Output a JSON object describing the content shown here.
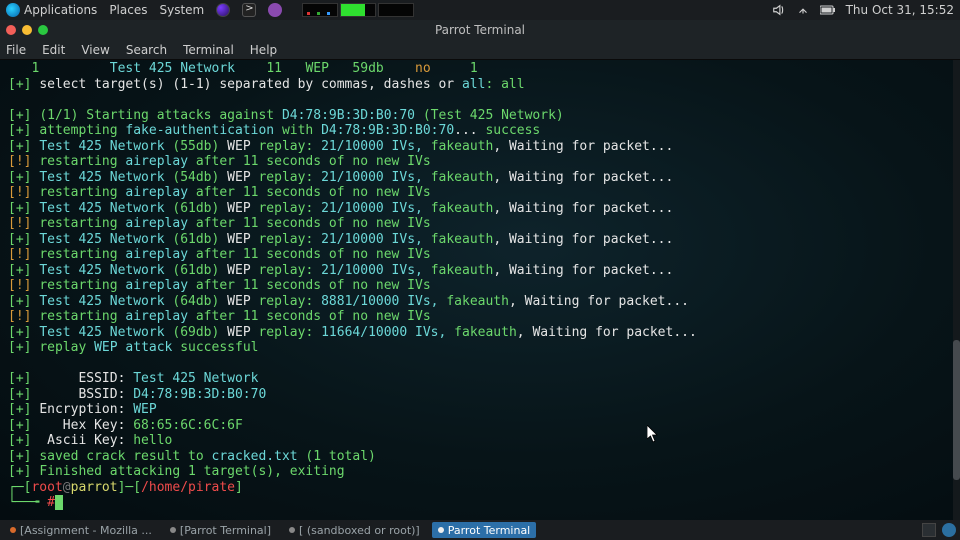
{
  "top_panel": {
    "app_menu": "Applications",
    "places": "Places",
    "system": "System",
    "clock": "Thu Oct 31, 15:52"
  },
  "window": {
    "title": "Parrot Terminal",
    "menu": {
      "file": "File",
      "edit": "Edit",
      "view": "View",
      "search": "Search",
      "terminal": "Terminal",
      "help": "Help"
    }
  },
  "term": {
    "scan_row": {
      "num": "1",
      "essid": "Test 425 Network",
      "ch": "11",
      "enc": "WEP",
      "pwr": "59db",
      "wps": "no",
      "cl": "1"
    },
    "select_prompt": "select target(s) (1-1) separated by commas, dashes or ",
    "select_all": "all",
    "select_answer": ": all",
    "start": "(1/1) Starting attacks against ",
    "bssid": "D4:78:9B:3D:B0:70",
    "start_tail": " (Test 425 Network)",
    "attempt": "attempting ",
    "fakeauth": "fake-authentication",
    "attempt2": " with ",
    "dots": "... ",
    "success": "success",
    "net_name": "Test 425 Network",
    "db55": "(55db)",
    "db54": "(54db)",
    "db61": "(61db)",
    "db64": "(64db)",
    "db69": "(69db)",
    "wep": " WEP",
    "replayw": " replay: ",
    "ivs21": "21/10000 IVs, ",
    "ivs8881": "8881/10000 IVs, ",
    "ivs11664": "11664/10000 IVs, ",
    "wait": ", Waiting for packet...",
    "fakeauth_s": "fakeauth",
    "restart1": "restarting ",
    "aireplay": "aireplay",
    "restart2": " after 11 seconds of no new IVs",
    "replay": "replay ",
    "wepattack": "WEP attack ",
    "successful": "successful",
    "essid_lbl": "     ESSID: ",
    "essid_val": "Test 425 Network",
    "bssid_lbl": "     BSSID: ",
    "enc_lbl": "Encryption: ",
    "enc_val": "WEP",
    "hex_lbl": "   Hex Key: ",
    "hex_val": "68:65:6C:6C:6F",
    "asc_lbl": " Ascii Key: ",
    "asc_val": "hello",
    "saved1": "saved crack result to ",
    "crackedfile": "cracked.txt",
    "saved2": " (1 total)",
    "finish": "Finished attacking 1 target(s), exiting",
    "p_root": "root",
    "p_at": "@",
    "p_host": "parrot",
    "p_sep1": "]",
    "p_dash": "─[",
    "p_path": "/home/pirate",
    "p_close": "]",
    "prompt2": "#"
  },
  "taskbar": {
    "t1": "[Assignment - Mozilla ...",
    "t2": "[Parrot Terminal]",
    "t3": "[ (sandboxed or root)]",
    "t4": "Parrot Terminal"
  }
}
